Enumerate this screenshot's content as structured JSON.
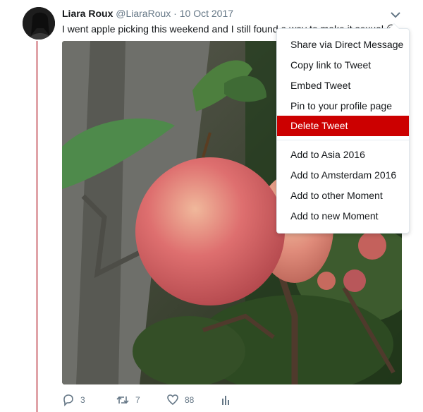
{
  "tweet": {
    "author_name": "Liara Roux",
    "author_handle": "@LiaraRoux",
    "separator": "·",
    "date": "10 Oct 2017",
    "text": "I went apple picking this weekend and I still found a way to make it sexual 😉"
  },
  "actions": {
    "reply_count": "3",
    "retweet_count": "7",
    "like_count": "88"
  },
  "menu": {
    "items": [
      {
        "label": "Share via Direct Message"
      },
      {
        "label": "Copy link to Tweet"
      },
      {
        "label": "Embed Tweet"
      },
      {
        "label": "Pin to your profile page"
      },
      {
        "label": "Delete Tweet"
      },
      {
        "label": "Add to Asia 2016"
      },
      {
        "label": "Add to Amsterdam 2016"
      },
      {
        "label": "Add to other Moment"
      },
      {
        "label": "Add to new Moment"
      }
    ]
  },
  "colors": {
    "thread_line": "#e0a3a8",
    "delete_highlight": "#cc0000",
    "muted_text": "#657786"
  }
}
